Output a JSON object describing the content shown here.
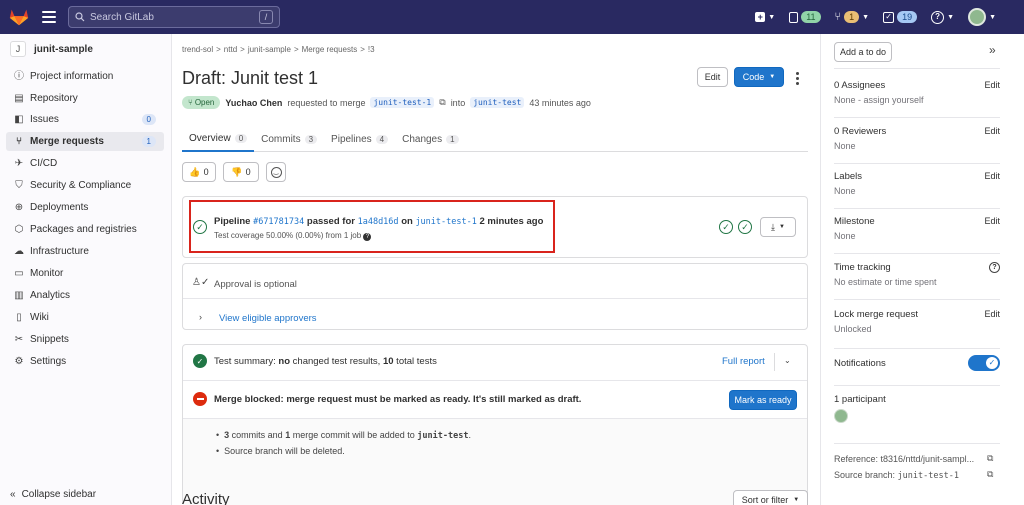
{
  "topbar": {
    "search_placeholder": "Search GitLab",
    "search_shortcut": "/",
    "issues_count": "11",
    "mr_count": "1",
    "todos_count": "19"
  },
  "sidebar": {
    "project_initial": "J",
    "project_name": "junit-sample",
    "items": [
      {
        "label": "Project information",
        "icon": "info-icon"
      },
      {
        "label": "Repository",
        "icon": "doc-icon"
      },
      {
        "label": "Issues",
        "icon": "issues-icon",
        "badge": "0"
      },
      {
        "label": "Merge requests",
        "icon": "merge-request-icon",
        "badge": "1"
      },
      {
        "label": "CI/CD",
        "icon": "rocket-icon"
      },
      {
        "label": "Security & Compliance",
        "icon": "shield-icon"
      },
      {
        "label": "Deployments",
        "icon": "deploy-icon"
      },
      {
        "label": "Packages and registries",
        "icon": "package-icon"
      },
      {
        "label": "Infrastructure",
        "icon": "cloud-icon"
      },
      {
        "label": "Monitor",
        "icon": "monitor-icon"
      },
      {
        "label": "Analytics",
        "icon": "chart-icon"
      },
      {
        "label": "Wiki",
        "icon": "book-icon"
      },
      {
        "label": "Snippets",
        "icon": "scissors-icon"
      },
      {
        "label": "Settings",
        "icon": "gear-icon"
      }
    ],
    "collapse_label": "Collapse sidebar"
  },
  "main": {
    "breadcrumb": [
      "trend-sol",
      ">",
      "nttd",
      ">",
      "junit-sample",
      ">",
      "Merge requests",
      ">",
      "!3"
    ],
    "title": "Draft: Junit test 1",
    "edit_label": "Edit",
    "code_label": "Code",
    "status": "Open",
    "author": "Yuchao Chen",
    "requested_text": "requested to merge",
    "source_branch": "junit-test-1",
    "into_text": "into",
    "target_branch": "junit-test",
    "time_ago": "43 minutes ago",
    "tabs": [
      {
        "label": "Overview",
        "count": "0"
      },
      {
        "label": "Commits",
        "count": "3"
      },
      {
        "label": "Pipelines",
        "count": "4"
      },
      {
        "label": "Changes",
        "count": "1"
      }
    ],
    "thumbs_up": "0",
    "thumbs_down": "0",
    "pipeline": {
      "prefix": "Pipeline",
      "id": "#671781734",
      "passed_for": "passed for",
      "commit": "1a48d16d",
      "on_text": "on",
      "branch": "junit-test-1",
      "time": "2 minutes ago",
      "coverage": "Test coverage 50.00% (0.00%) from 1 job"
    },
    "approval": {
      "text": "Approval is optional",
      "link": "View eligible approvers"
    },
    "test_summary": {
      "prefix": "Test summary: ",
      "bold1": "no",
      "mid": " changed test results, ",
      "bold2": "10",
      "suffix": " total tests",
      "full_report": "Full report"
    },
    "merge_blocked": {
      "text": "Merge blocked: merge request must be marked as ready. It's still marked as draft.",
      "button": "Mark as ready"
    },
    "commits_info": {
      "line1_a": "3",
      "line1_b": " commits and ",
      "line1_c": "1",
      "line1_d": " merge commit will be added to ",
      "line1_branch": "junit-test",
      "line1_end": ".",
      "line2": "Source branch will be deleted."
    },
    "activity_title": "Activity",
    "sort_label": "Sort or filter"
  },
  "right_sidebar": {
    "todo_label": "Add a to do",
    "assignees_title": "0 Assignees",
    "assignees_value": "None - assign yourself",
    "reviewers_title": "0 Reviewers",
    "reviewers_value": "None",
    "labels_title": "Labels",
    "labels_value": "None",
    "milestone_title": "Milestone",
    "milestone_value": "None",
    "time_title": "Time tracking",
    "time_value": "No estimate or time spent",
    "lock_title": "Lock merge request",
    "lock_value": "Unlocked",
    "notifications_title": "Notifications",
    "participants_title": "1 participant",
    "reference": "Reference: t8316/nttd/junit-sampl...",
    "source_branch_label": "Source branch: ",
    "source_branch_value": "junit-test-1",
    "edit_label": "Edit"
  },
  "colors": {
    "topbar": "#292961",
    "primary": "#1f75cb",
    "success": "#217645",
    "danger": "#dd2b0e",
    "highlight_box": "#d9241c"
  }
}
